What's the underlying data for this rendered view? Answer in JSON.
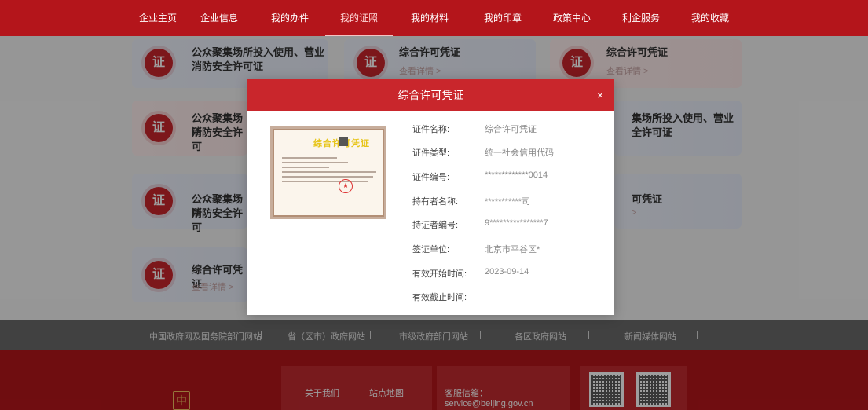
{
  "nav": {
    "items": [
      "企业主页",
      "企业信息",
      "我的办件",
      "我的证照",
      "我的材料",
      "我的印章",
      "政策中心",
      "利企服务",
      "我的收藏"
    ],
    "active_index": 3
  },
  "cards": {
    "badge": "证",
    "c1": {
      "title": "公众聚集场所投入使用、营业消防安全许可证"
    },
    "c2": {
      "title": "综合许可凭证",
      "sub": "查看详情 >"
    },
    "c3": {
      "title": "综合许可凭证",
      "sub": "查看详情 >"
    },
    "c4": {
      "title": "公众聚集场所",
      "title2": "消防安全许可"
    },
    "c5": {
      "title": "集场所投入使用、营业",
      "title2": "全许可证"
    },
    "c6": {
      "title": "公众聚集场所",
      "title2": "消防安全许可"
    },
    "c7": {
      "title": "可凭证",
      "sub": ">"
    },
    "c8": {
      "title": "综合许可凭证",
      "sub": "查看详情 >"
    }
  },
  "modal": {
    "title": "综合许可凭证",
    "close": "×",
    "cert_title": "综合许可凭证",
    "fields": [
      {
        "label": "证件名称:",
        "value": "综合许可凭证"
      },
      {
        "label": "证件类型:",
        "value": "统一社会信用代码"
      },
      {
        "label": "证件编号:",
        "value": "*************0014"
      },
      {
        "label": "持有者名称:",
        "value": "***********司"
      },
      {
        "label": "持证者编号:",
        "value": "9****************7"
      },
      {
        "label": "签证单位:",
        "value": "北京市平谷区*"
      },
      {
        "label": "有效开始时间:",
        "value": "2023-09-14"
      },
      {
        "label": "有效截止时间:",
        "value": ""
      }
    ]
  },
  "links_bar": {
    "items": [
      "中国政府网及国务院部门网站",
      "省（区市）政府网站",
      "市级政府部门网站",
      "各区政府网站",
      "新闻媒体网站"
    ],
    "separator": "|"
  },
  "footer": {
    "about": "关于我们",
    "sitemap": "站点地图",
    "email": "客服信箱：service@beijing.gov.cn",
    "emblem": "中"
  },
  "colors": {
    "primary": "#c9262c",
    "nav_bg": "#b4151b"
  }
}
